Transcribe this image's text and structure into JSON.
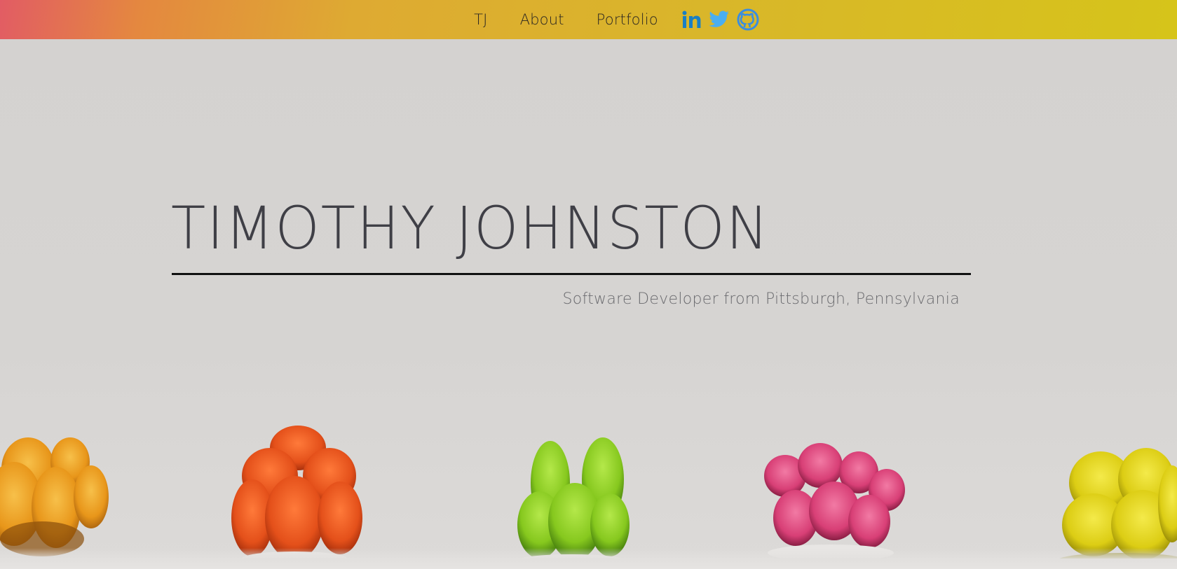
{
  "nav": {
    "items": [
      {
        "label": "TJ"
      },
      {
        "label": "About"
      },
      {
        "label": "Portfolio"
      }
    ],
    "social": [
      {
        "icon": "linkedin-icon",
        "color": "#1a7fc4"
      },
      {
        "icon": "twitter-icon",
        "color": "#4aaef0"
      },
      {
        "icon": "github-icon",
        "color": "#3a8de0"
      }
    ],
    "gradient": [
      "#e25c64",
      "#e4883f",
      "#deaa32",
      "#d6c41a"
    ]
  },
  "hero": {
    "title": "TIMOTHY JOHNSTON",
    "subtitle": "Software Developer from Pittsburgh, Pennsylvania"
  },
  "background": {
    "description_colors": {
      "backdrop": "#d5d3d1",
      "cactus_colors": [
        "#f0a21c",
        "#f25a1a",
        "#8ed11e",
        "#e0437a",
        "#e4d612"
      ]
    }
  }
}
